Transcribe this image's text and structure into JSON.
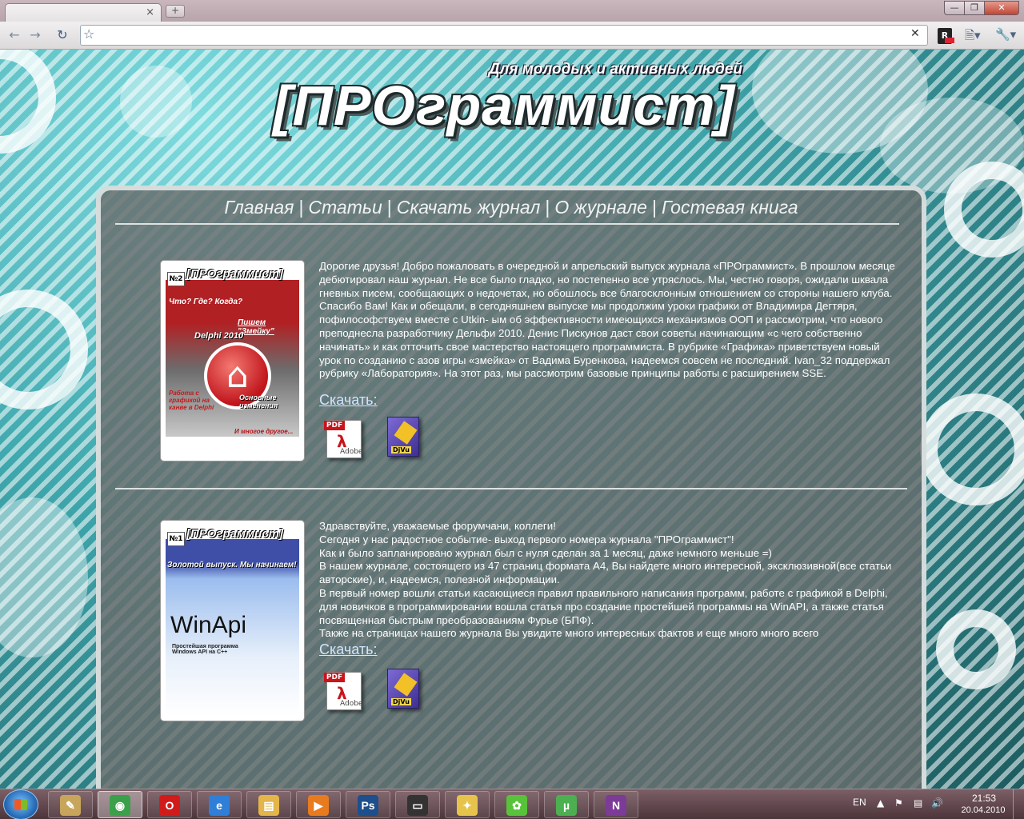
{
  "browser": {
    "tab_title": "",
    "tab_close": "×",
    "new_tab": "+",
    "url": "",
    "window_buttons": {
      "minimize": "—",
      "maximize": "❐",
      "close": "✕"
    },
    "nav_icons": [
      "back-icon",
      "forward-icon",
      "reload-icon",
      "bookmark-star-icon"
    ],
    "extension_label": "R",
    "clear_label": "✕"
  },
  "site": {
    "tagline": "Для молодых и активных людей",
    "logo": "[ПРОграммист]",
    "nav": [
      "Главная",
      "Статьи",
      "Скачать журнал",
      "О журнале",
      "Гостевая книга"
    ],
    "nav_separator": "|"
  },
  "issues": [
    {
      "cover": {
        "number": "№2",
        "title": "[ПРОграммист]",
        "lines": [
          "Что? Где? Когда?",
          "Пишем \"Змейку\"",
          "Delphi 2010",
          "Основные изменения",
          "Работа с графикой на канве в Delphi",
          "И многое другое..."
        ]
      },
      "paragraphs": [
        "Дорогие друзья! Добро пожаловать в очередной и апрельский выпуск журнала «ПРОграммист». В прошлом месяце дебютировал наш журнал. Не все было гладко, но постепенно все утряслось. Мы, честно говоря, ожидали шквала гневных писем, сообщающих о недочетах, но обошлось все благосклонным отношением со стороны нашего клуба. Спасибо Вам! Как и обещали, в сегодняшнем выпуске мы продолжим уроки графики от Владимира Дегтяря, пофилософствуем вместе с Utkin- ым об эффективности имеющихся механизмов ООП и рассмотрим, что нового преподнесла разработчику Дельфи 2010. Денис Пискунов даст свои советы начинающим «с чего собственно начинать» и как отточить свое мастерство настоящего программиста. В рубрике «Графика» приветствуем новый урок по созданию с азов игры «змейка» от Вадима Буренкова, надеемся совсем не последний. Ivan_32 поддержал рубрику «Лаборатория». На этот раз, мы рассмотрим базовые принципы работы с расширением SSE."
      ],
      "download_label": "Скачать:",
      "downloads": [
        {
          "icon": "pdf-icon",
          "tag": "PDF",
          "caption": "Adobe"
        },
        {
          "icon": "djvu-icon",
          "caption": "DjVu"
        }
      ]
    },
    {
      "cover": {
        "number": "№1",
        "title": "[ПРОграммист]",
        "lines": [
          "Золотой выпуск. Мы начинаем!",
          "WinApi",
          "Простейшая программа Windows API на C++"
        ]
      },
      "paragraphs": [
        "Здравствуйте, уважаемые форумчани, коллеги!",
        "Сегодня у нас радостное событие- выход первого номера журнала \"ПРОграммист\"!",
        "Как и было запланировано журнал был с нуля сделан за 1 месяц, даже немного меньше =)",
        "В нашем журнале, состоящего из 47 страниц формата А4, Вы найдете много интересной, эксклюзивной(все статьи авторские), и, надеемся, полезной информации.",
        "В первый номер вошли статьи касающиеся правил правильного написания программ, работе с графикой в Delphi, для новичков в программировании вошла статья про создание простейшей программы на WinAPI, а также статья посвященная быстрым преобразованиям Фурье (БПФ).",
        "Также на страницах нашего журнала Вы увидите много интересных фактов и еще много много всего"
      ],
      "download_label": "Скачать:",
      "downloads": [
        {
          "icon": "pdf-icon",
          "tag": "PDF",
          "caption": "Adobe"
        },
        {
          "icon": "djvu-icon",
          "caption": "DjVu"
        }
      ]
    }
  ],
  "taskbar": {
    "apps": [
      {
        "name": "notepad",
        "glyph": "✎",
        "color": "#c7a55a",
        "active": false
      },
      {
        "name": "chrome",
        "glyph": "◉",
        "color": "#3aa04a",
        "active": true
      },
      {
        "name": "opera",
        "glyph": "O",
        "color": "#d11b1b",
        "active": false
      },
      {
        "name": "internet-explorer",
        "glyph": "e",
        "color": "#2f7fd8",
        "active": false
      },
      {
        "name": "explorer",
        "glyph": "▤",
        "color": "#e3b54a",
        "active": false
      },
      {
        "name": "media-player",
        "glyph": "▶",
        "color": "#e87b1e",
        "active": false
      },
      {
        "name": "photoshop",
        "glyph": "Ps",
        "color": "#1c4f8c",
        "active": false
      },
      {
        "name": "display-settings",
        "glyph": "▭",
        "color": "#333",
        "active": false
      },
      {
        "name": "paint",
        "glyph": "✦",
        "color": "#e6c34b",
        "active": false
      },
      {
        "name": "icq",
        "glyph": "✿",
        "color": "#58c33a",
        "active": false
      },
      {
        "name": "utorrent",
        "glyph": "µ",
        "color": "#4cb050",
        "active": false
      },
      {
        "name": "onenote",
        "glyph": "N",
        "color": "#7b3b97",
        "active": false
      }
    ],
    "language": "EN",
    "time": "21:53",
    "date": "20.04.2010",
    "tray_icons": [
      "show-hidden-icon",
      "flag-icon",
      "network-icon",
      "volume-icon"
    ]
  }
}
